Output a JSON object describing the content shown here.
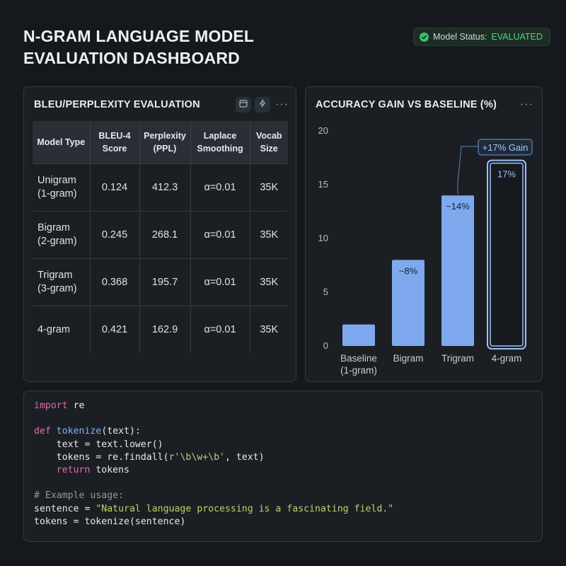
{
  "header": {
    "title_line1": "N-GRAM LANGUAGE MODEL",
    "title_line2": "EVALUATION DASHBOARD",
    "status_label": "Model Status:",
    "status_value": "EVALUATED",
    "status_color": "#56d07c"
  },
  "table_card": {
    "title": "BLEU/PERPLEXITY EVALUATION",
    "icons": [
      "calendar-icon",
      "lightning-icon",
      "more-icon"
    ],
    "columns": [
      [
        "Model Type"
      ],
      [
        "BLEU-4",
        "Score"
      ],
      [
        "Perplexity",
        "(PPL)"
      ],
      [
        "Laplace",
        "Smoothing"
      ],
      [
        "Vocab",
        "Size"
      ]
    ],
    "rows": [
      {
        "model": [
          "Unigram",
          "(1-gram)"
        ],
        "bleu": "0.124",
        "ppl": "412.3",
        "smoothing": "α=0.01",
        "vocab": "35K"
      },
      {
        "model": [
          "Bigram",
          "(2-gram)"
        ],
        "bleu": "0.245",
        "ppl": "268.1",
        "smoothing": "α=0.01",
        "vocab": "35K"
      },
      {
        "model": [
          "Trigram",
          "(3-gram)"
        ],
        "bleu": "0.368",
        "ppl": "195.7",
        "smoothing": "α=0.01",
        "vocab": "35K"
      },
      {
        "model": [
          "4-gram"
        ],
        "bleu": "0.421",
        "ppl": "162.9",
        "smoothing": "α=0.01",
        "vocab": "35K"
      }
    ]
  },
  "chart_card": {
    "title": "ACCURACY GAIN VS BASELINE (%)"
  },
  "chart_data": {
    "type": "bar",
    "title": "ACCURACY GAIN VS BASELINE (%)",
    "categories": [
      [
        "Baseline",
        "(1-gram)"
      ],
      [
        "Bigram"
      ],
      [
        "Trigram"
      ],
      [
        "4-gram"
      ]
    ],
    "values": [
      2,
      8,
      14,
      17
    ],
    "data_labels": [
      "",
      "~8%",
      "~14%",
      "17%"
    ],
    "highlight_index": 3,
    "annotation": "+17% Gain",
    "ylim": [
      0,
      20
    ],
    "yticks": [
      0,
      5,
      10,
      15,
      20
    ],
    "bar_color": "#7fa9ee",
    "highlight_color": "#9cc0f7",
    "grid": false
  },
  "code": [
    [
      [
        "kw",
        "import"
      ],
      [
        "",
        " re"
      ]
    ],
    [],
    [
      [
        "kw",
        "def"
      ],
      [
        "",
        " "
      ],
      [
        "fn",
        "tokenize"
      ],
      [
        "",
        "(text):"
      ]
    ],
    [
      [
        "",
        "    text = text.lower()"
      ]
    ],
    [
      [
        "",
        "    tokens = re.findall("
      ],
      [
        "str",
        "r'\\b\\w+\\b'"
      ],
      [
        "",
        ", text)"
      ]
    ],
    [
      [
        "",
        "    "
      ],
      [
        "kw",
        "return"
      ],
      [
        "",
        " tokens"
      ]
    ],
    [],
    [
      [
        "cm",
        "# Example usage:"
      ]
    ],
    [
      [
        "",
        "sentence = "
      ],
      [
        "str",
        "\"Natural language processing is a fascinating field.\""
      ]
    ],
    [
      [
        "",
        "tokens = tokenize(sentence)"
      ]
    ]
  ]
}
